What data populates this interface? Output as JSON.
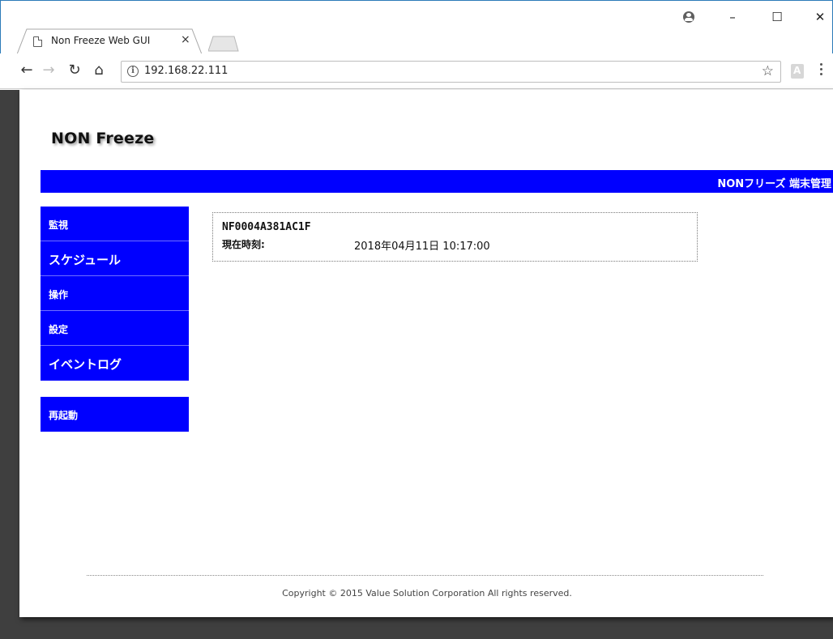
{
  "browser": {
    "tab_title": "Non Freeze Web GUI",
    "tab_close": "×",
    "url": "192.168.22.111",
    "window_controls": {
      "minimize": "–",
      "maximize": "☐",
      "close": "✕"
    },
    "icons": [
      "back-arrow-icon",
      "forward-arrow-icon",
      "reload-icon",
      "home-icon",
      "info-icon",
      "star-icon",
      "profile-icon",
      "menu-icon"
    ]
  },
  "page": {
    "logo": "NON Freeze",
    "header_title": "NONフリーズ  端末管理",
    "nav": {
      "monitor": "監視",
      "schedule": "スケジュール",
      "operation": "操作",
      "settings": "設定",
      "event_log": "イベントログ",
      "restart": "再起動"
    },
    "device": {
      "id": "NF0004A381AC1F",
      "time_label": "現在時刻:",
      "time_value": "2018年04月11日 10:17:00"
    },
    "footer": "Copyright © 2015 Value Solution Corporation All rights reserved."
  },
  "colors": {
    "nav_blue": "#0000ff",
    "frame_blue": "#2b7bb9",
    "viewport_gray": "#3f3f3f"
  }
}
